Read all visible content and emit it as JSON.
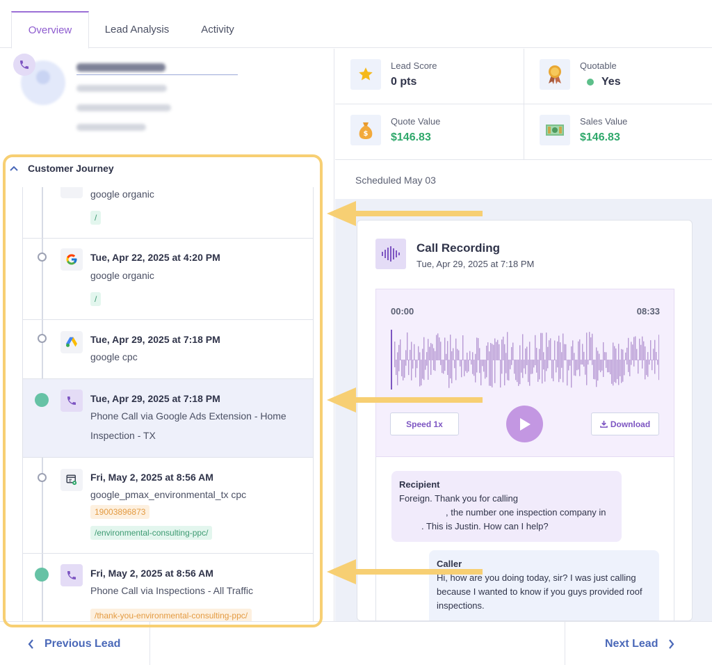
{
  "tabs": [
    {
      "label": "Overview",
      "active": true
    },
    {
      "label": "Lead Analysis",
      "active": false
    },
    {
      "label": "Activity",
      "active": false
    }
  ],
  "contact": {
    "name": "Goldberg Asahel",
    "email": "(No Email Address)",
    "company": "(No Company Name)",
    "phone": "+12146588978"
  },
  "metrics": {
    "lead_score": {
      "label": "Lead Score",
      "value": "0 pts",
      "icon": "star-icon"
    },
    "quotable": {
      "label": "Quotable",
      "value": "Yes",
      "icon": "award-ribbon-icon"
    },
    "quote_value": {
      "label": "Quote Value",
      "value": "$146.83",
      "icon": "money-bag-icon"
    },
    "sales_value": {
      "label": "Sales Value",
      "value": "$146.83",
      "icon": "cash-stack-icon"
    }
  },
  "scheduled": "Scheduled May 03",
  "journey": {
    "title": "Customer Journey",
    "events": [
      {
        "date": "",
        "source": "google organic",
        "tags": [
          "/"
        ]
      },
      {
        "date": "Tue, Apr 22, 2025 at 4:20 PM",
        "source": "google organic",
        "tags": [
          "/"
        ],
        "icon": "google-icon"
      },
      {
        "date": "Tue, Apr 29, 2025 at 7:18 PM",
        "source": "google cpc",
        "tags": [],
        "icon": "google-ads-icon"
      },
      {
        "date": "Tue, Apr 29, 2025 at 7:18 PM",
        "source": "Phone Call via Google Ads Extension - Home",
        "source2": "Inspection - TX",
        "tags": [],
        "icon": "phone-icon",
        "highlight": true
      },
      {
        "date": "Fri, May 2, 2025 at 8:56 AM",
        "source": "google_pmax_environmental_tx cpc",
        "tags": [
          "19003896873",
          "/environmental-consulting-ppc/"
        ],
        "icon": "form-icon"
      },
      {
        "date": "Fri, May 2, 2025 at 8:56 AM",
        "source": "Phone Call via Inspections - All Traffic",
        "tags": [
          "/thank-you-environmental-consulting-ppc/"
        ],
        "icon": "phone-icon"
      }
    ]
  },
  "recording": {
    "title": "Call Recording",
    "subtitle": "Tue, Apr 29, 2025 at 7:18 PM",
    "time_start": "00:00",
    "time_end": "08:33",
    "speed_label": "Speed 1x",
    "download_label": "Download"
  },
  "transcript": [
    {
      "speaker": "Recipient",
      "lines": [
        "Foreign. Thank you for calling",
        ", the number one inspection company in",
        ". This is Justin. How can I help?"
      ]
    },
    {
      "speaker": "Caller",
      "lines": [
        "Hi, how are you doing today, sir? I was just calling",
        "because I wanted to know if you guys provided roof",
        "inspections."
      ]
    }
  ],
  "nav": {
    "prev": "Previous Lead",
    "next": "Next Lead"
  },
  "colors": {
    "accent": "#8e5ccf",
    "highlight_box": "#f7cf73",
    "money": "#2fa86b",
    "link": "#4a68b8"
  }
}
